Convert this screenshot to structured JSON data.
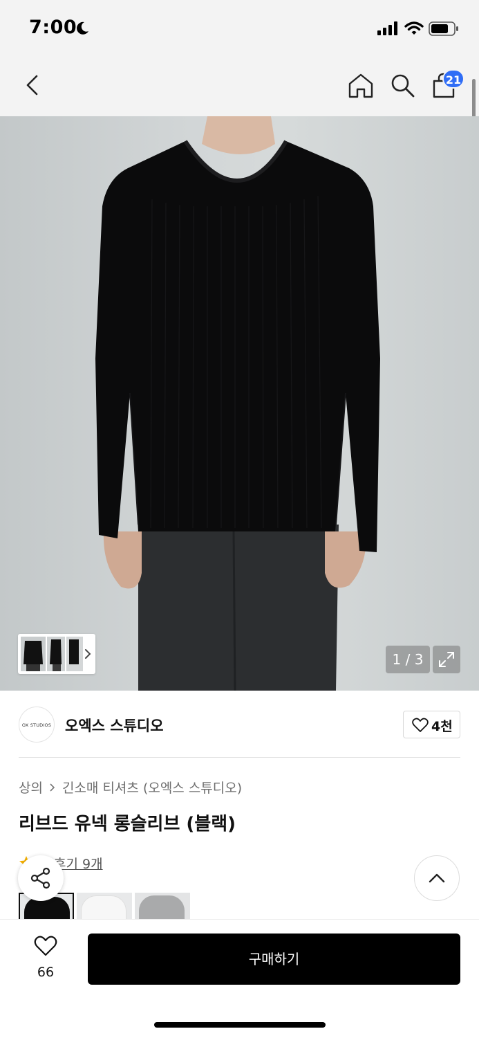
{
  "status_bar": {
    "time": "7:00",
    "icons": [
      "moon-icon",
      "signal-icon",
      "wifi-icon",
      "battery-icon"
    ]
  },
  "nav": {
    "icons": [
      "back-icon",
      "home-icon",
      "search-icon",
      "cart-icon"
    ],
    "cart_badge": "21"
  },
  "gallery": {
    "counter": "1 / 3",
    "current_page": 1,
    "total_pages": 3,
    "icons": [
      "chevron-right-icon",
      "expand-icon"
    ]
  },
  "brand": {
    "logo_text": "OX STUDIOS",
    "name": "오엑스 스튜디오",
    "like_count": "4천"
  },
  "breadcrumb": [
    "상의",
    "긴소매 티셔츠 (오엑스 스튜디오)"
  ],
  "product": {
    "title": "리브드 유넥 롱슬리브 (블랙)",
    "review_text": "후기 9개"
  },
  "swatches": [
    {
      "name": "black",
      "color": "#0d0d0d",
      "selected": true
    },
    {
      "name": "white",
      "color": "#f4f4f4",
      "selected": false
    },
    {
      "name": "gray",
      "color": "#a9aaab",
      "selected": false
    }
  ],
  "bottom_bar": {
    "wish_count": "66",
    "buy_label": "구매하기"
  },
  "colors": {
    "accent": "#2f6df6",
    "header_bg": "#f3f3f3",
    "buy_button": "#000000",
    "review_star": "#f5b000"
  }
}
